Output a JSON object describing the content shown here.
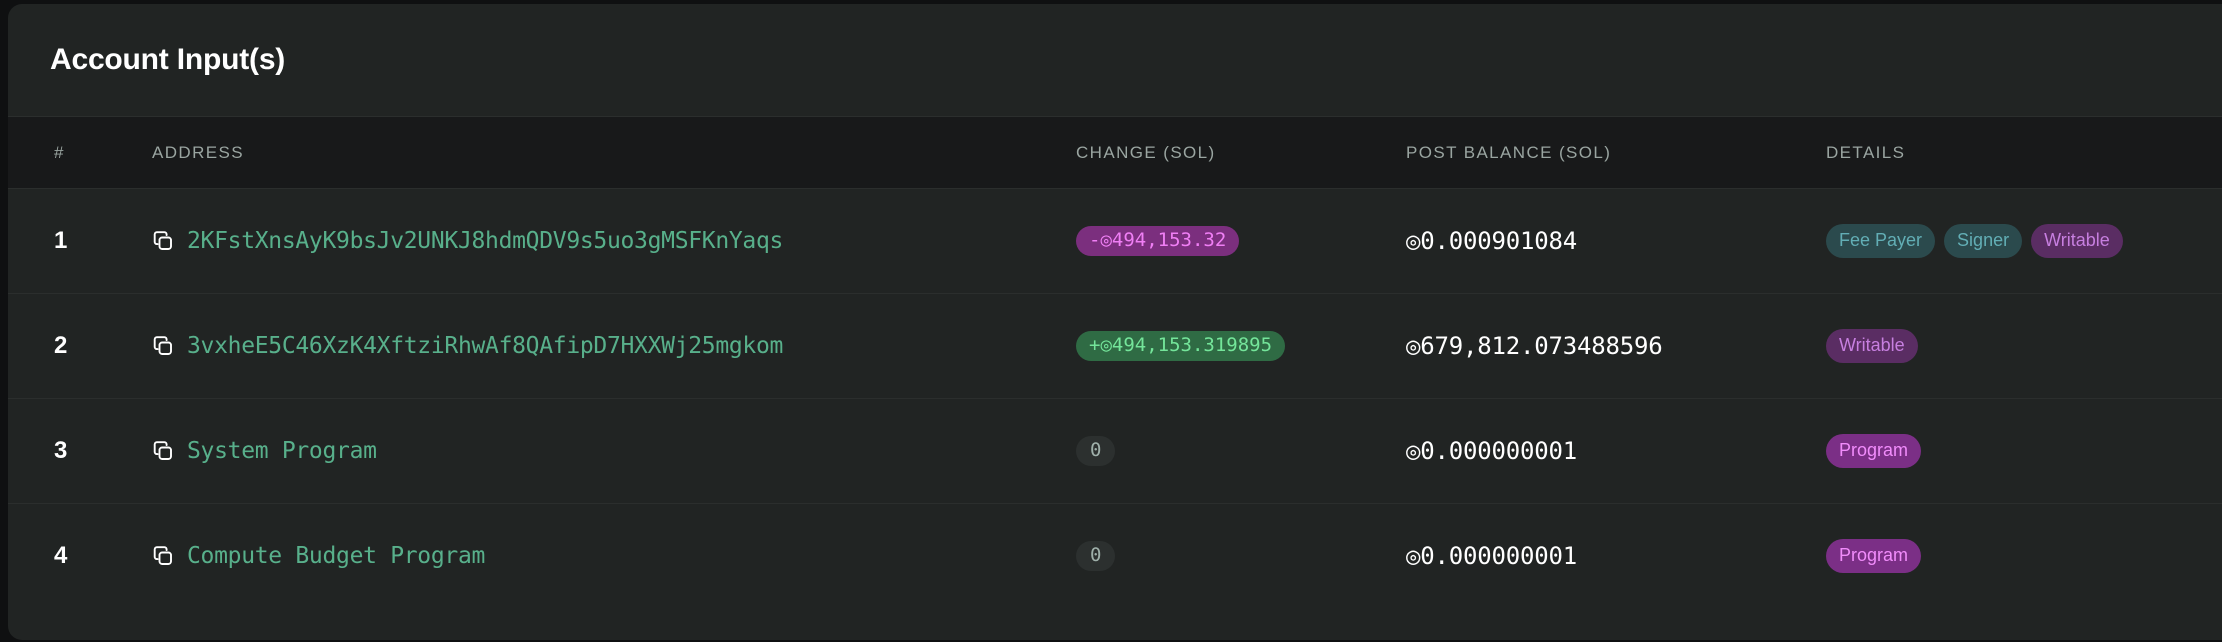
{
  "card": {
    "title": "Account Input(s)"
  },
  "colors": {
    "page_bg": "#0f1011",
    "card_bg": "#212423",
    "header_bg": "#18191a",
    "row_divider": "#2b2e2d",
    "address_green": "#58b08b",
    "negative_badge_bg": "#7b2f7e",
    "negative_badge_text": "#f07ff5",
    "positive_badge_bg": "#2f6b44",
    "positive_badge_text": "#74e59a",
    "zero_badge_bg": "#2c302f",
    "zero_badge_text": "#9fb0aa",
    "tag_teal_bg": "#2b4a4d",
    "tag_teal_text": "#62aeb5",
    "tag_purple_bg": "#5a2d63",
    "tag_purple_text": "#c77fe0",
    "tag_program_bg": "#7b2f86",
    "tag_program_text": "#f18cfb",
    "balance_text": "#ffffff",
    "header_text": "#9aa5a1"
  },
  "table": {
    "columns": [
      "#",
      "ADDRESS",
      "CHANGE (SOL)",
      "POST BALANCE (SOL)",
      "DETAILS"
    ],
    "rows": [
      {
        "index": "1",
        "copy_icon": "copy-icon",
        "address": "2KFstXnsAyK9bsJv2UNKJ8hdmQDV9s5uo3gMSFKnYaqs",
        "change": "-◎494,153.32",
        "change_sign": "negative",
        "post_balance": "◎0.000901084",
        "details": [
          {
            "label": "Fee Payer",
            "style": "teal"
          },
          {
            "label": "Signer",
            "style": "teal"
          },
          {
            "label": "Writable",
            "style": "purple"
          }
        ]
      },
      {
        "index": "2",
        "copy_icon": "copy-icon",
        "address": "3vxheE5C46XzK4XftziRhwAf8QAfipD7HXXWj25mgkom",
        "change": "+◎494,153.319895",
        "change_sign": "positive",
        "post_balance": "◎679,812.073488596",
        "details": [
          {
            "label": "Writable",
            "style": "purple"
          }
        ]
      },
      {
        "index": "3",
        "copy_icon": "copy-icon",
        "address": "System Program",
        "change": "0",
        "change_sign": "zero",
        "post_balance": "◎0.000000001",
        "details": [
          {
            "label": "Program",
            "style": "program"
          }
        ]
      },
      {
        "index": "4",
        "copy_icon": "copy-icon",
        "address": "Compute Budget Program",
        "change": "0",
        "change_sign": "zero",
        "post_balance": "◎0.000000001",
        "details": [
          {
            "label": "Program",
            "style": "program"
          }
        ]
      }
    ]
  }
}
